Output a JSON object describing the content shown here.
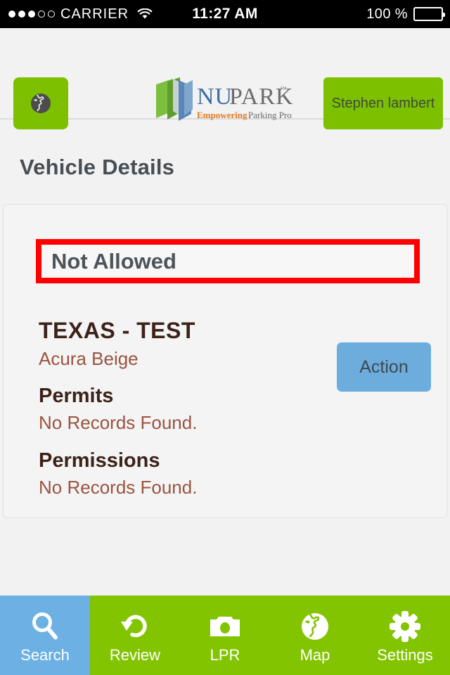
{
  "status_bar": {
    "signal_dots_filled": 3,
    "signal_dots_total": 5,
    "carrier": "CARRIER",
    "wifi_icon": "wifi-icon",
    "time": "11:27 AM",
    "battery_percent": "100 %",
    "battery_level": 100
  },
  "header": {
    "globe_button_icon": "globe-icon",
    "logo": {
      "name_part1": "NU",
      "name_part2": "PARK",
      "trademark": "™",
      "tagline_accent": "Empowering",
      "tagline_rest": "Parking Professionals"
    },
    "user_button_label": "Stephen lambert"
  },
  "page": {
    "title": "Vehicle Details"
  },
  "card": {
    "alert": {
      "text": "Not Allowed",
      "border_color": "#ff0000"
    },
    "vehicle": {
      "plate": "TEXAS - TEST",
      "description": "Acura Beige"
    },
    "action_button_label": "Action",
    "action_button_color": "#6cadde",
    "sections": [
      {
        "heading": "Permits",
        "body": "No Records Found."
      },
      {
        "heading": "Permissions",
        "body": "No Records Found."
      }
    ]
  },
  "tabbar": {
    "active_color": "#6cb0e4",
    "background_color": "#82c400",
    "items": [
      {
        "label": "Search",
        "icon": "search-icon",
        "active": true
      },
      {
        "label": "Review",
        "icon": "undo-arrow-icon",
        "active": false
      },
      {
        "label": "LPR",
        "icon": "camera-icon",
        "active": false
      },
      {
        "label": "Map",
        "icon": "globe-icon",
        "active": false
      },
      {
        "label": "Settings",
        "icon": "gear-icon",
        "active": false
      }
    ]
  }
}
